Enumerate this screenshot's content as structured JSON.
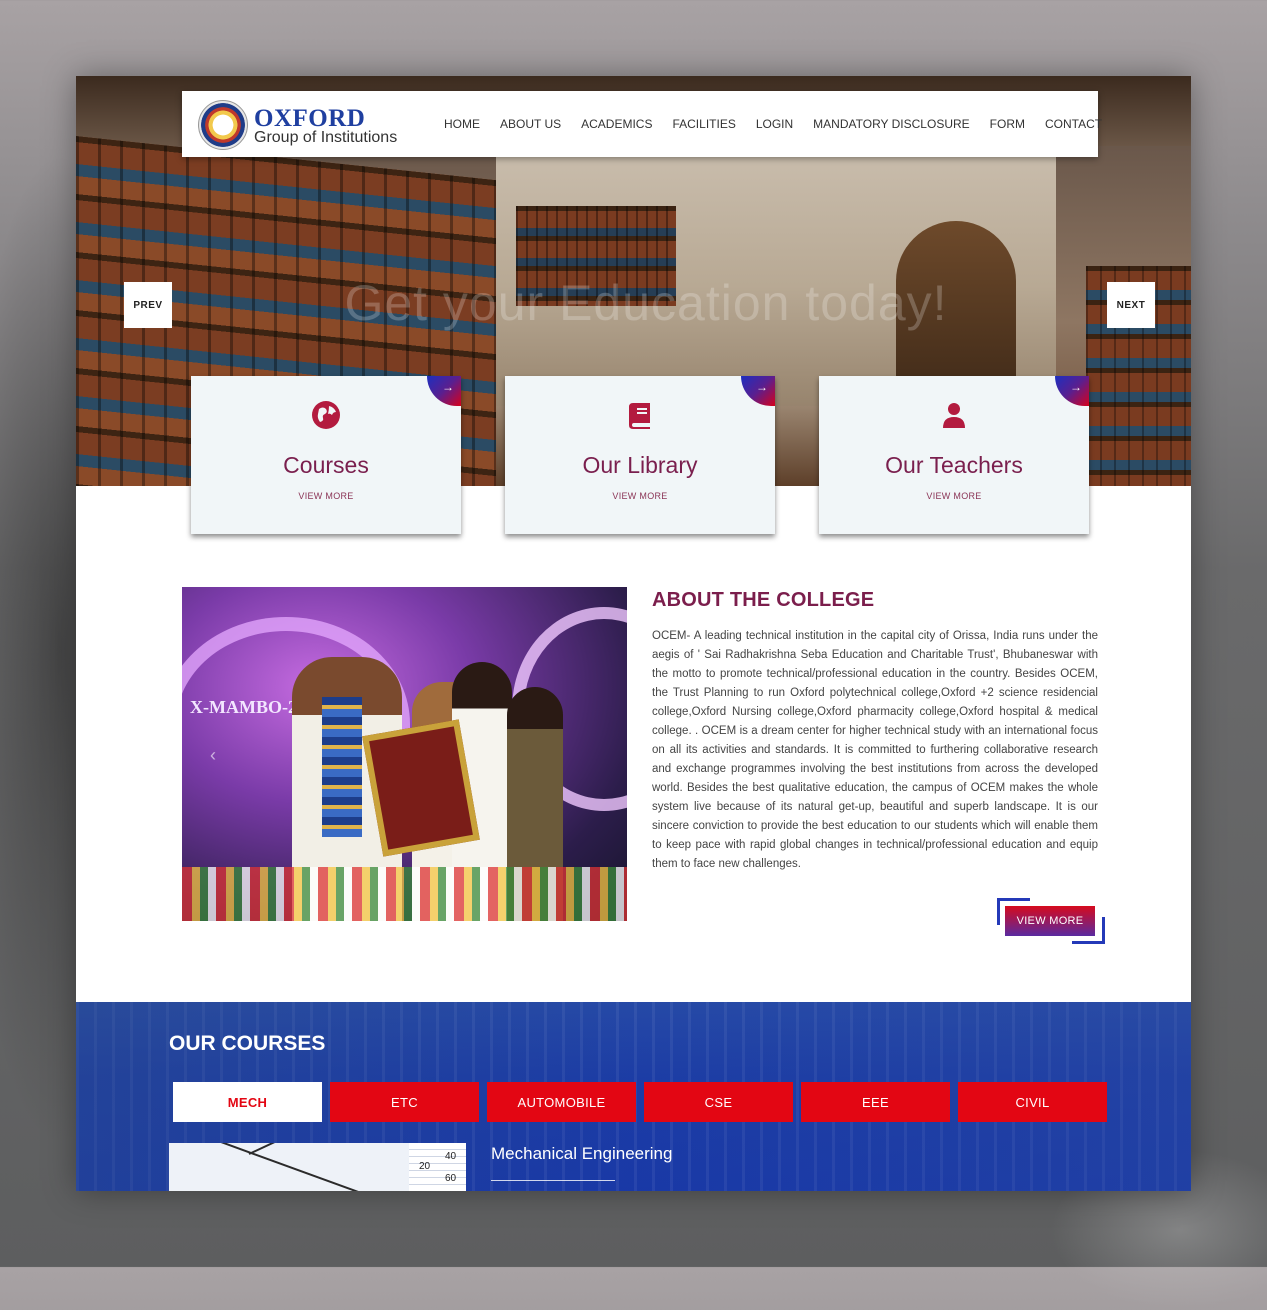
{
  "brand": {
    "name": "OXFORD",
    "subtitle": "Group of Institutions"
  },
  "nav": {
    "items": [
      "HOME",
      "ABOUT US",
      "ACADEMICS",
      "FACILITIES",
      "LOGIN",
      "MANDATORY DISCLOSURE",
      "FORM",
      "CONTACT"
    ]
  },
  "hero": {
    "title": "Get your Education today!",
    "prev_label": "PREV",
    "next_label": "NEXT"
  },
  "features": [
    {
      "title": "Courses",
      "link": "VIEW MORE",
      "icon": "globe-icon",
      "corner": "→"
    },
    {
      "title": "Our Library",
      "link": "VIEW MORE",
      "icon": "book-icon",
      "corner": "→"
    },
    {
      "title": "Our Teachers",
      "link": "VIEW MORE",
      "icon": "user-icon",
      "corner": "→"
    }
  ],
  "about": {
    "heading": "ABOUT THE COLLEGE",
    "text": "OCEM- A leading technical institution in the capital city of Orissa, India runs under the aegis of ' Sai Radhakrishna Seba Education and Charitable Trust', Bhubaneswar with the motto to promote technical/professional education in the country. Besides OCEM, the Trust Planning to run Oxford polytechnical college,Oxford +2 science residencial college,Oxford Nursing college,Oxford pharmacity college,Oxford hospital & medical college. . OCEM is a dream center for higher technical study with an international focus on all its activities and standards. It is committed to furthering collaborative research and exchange programmes involving the best institutions from across the developed world. Besides the best qualitative education, the campus of OCEM makes the whole system live because of its natural get-up, beautiful and superb landscape. It is our sincere conviction to provide the best education to our students which will enable them to keep pace with rapid global changes in technical/professional education and equip them to face new challenges.",
    "button": "VIEW MORE",
    "image_text": "X-MAMBO-201"
  },
  "courses": {
    "title": "OUR COURSES",
    "tabs": [
      "MECH",
      "ETC",
      "AUTOMOBILE",
      "CSE",
      "EEE",
      "CIVIL"
    ],
    "active_tab": "MECH",
    "current_name": "Mechanical Engineering",
    "image_numbers": [
      "20",
      "40",
      "60"
    ]
  },
  "colors": {
    "accent_red": "#e30613",
    "accent_blue": "#1e3fa6",
    "heading_maroon": "#7b1e4c"
  }
}
